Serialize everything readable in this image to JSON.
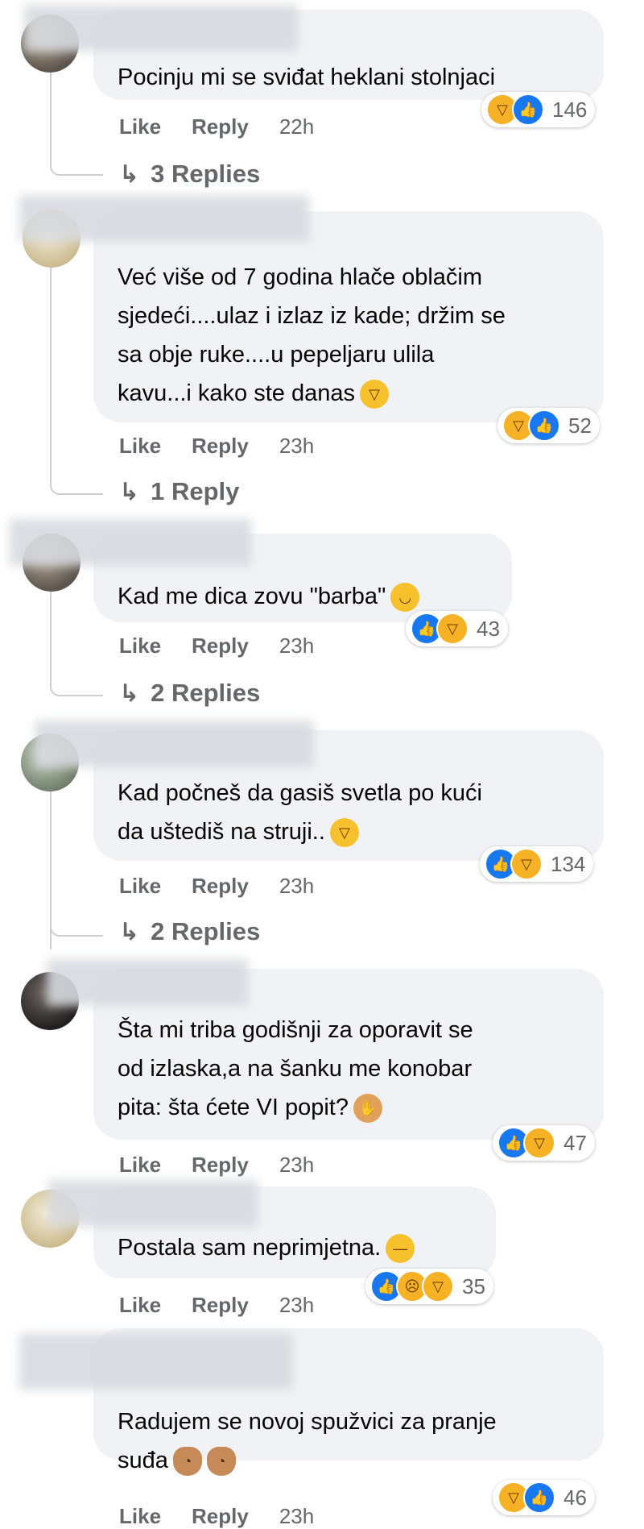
{
  "labels": {
    "like": "Like",
    "reply": "Reply"
  },
  "icons": {
    "reply_arrow": "reply-arrow-icon",
    "like_reaction": "like-reaction-icon",
    "haha_reaction": "haha-reaction-icon",
    "sad_reaction": "sad-reaction-icon"
  },
  "colors": {
    "bubble": "#f0f2f5",
    "like_blue": "#1877f2",
    "haha_yellow": "#f7b125",
    "meta_gray": "#65676b"
  },
  "comments": [
    {
      "text": "Pocinju mi se sviđat heklani stolnjaci",
      "count": "146",
      "time": "22h",
      "replies": "3 Replies"
    },
    {
      "text": "Već više od 7 godina hlače oblačim\nsjedeći....ulaz i izlaz iz kade; držim se\nsa obje ruke....u pepeljaru ulila\nkavu...i kako ste danas",
      "count": "52",
      "time": "23h",
      "replies": "1 Reply"
    },
    {
      "text": "Kad me dica zovu \"barba\"",
      "count": "43",
      "time": "23h",
      "replies": "2 Replies"
    },
    {
      "text": "Kad počneš da gasiš svetla po kući\nda uštediš na struji..",
      "count": "134",
      "time": "23h",
      "replies": "2 Replies"
    },
    {
      "text": "Šta mi triba godišnji za oporavit se\nod izlaska,a na šanku me konobar\npita: šta ćete VI popit?",
      "count": "47",
      "time": "23h"
    },
    {
      "text": "Postala sam neprimjetna.",
      "count": "35",
      "time": "23h"
    },
    {
      "text": "Radujem se novoj spužvici za pranje\nsuđa",
      "count": "46",
      "time": "23h"
    }
  ]
}
